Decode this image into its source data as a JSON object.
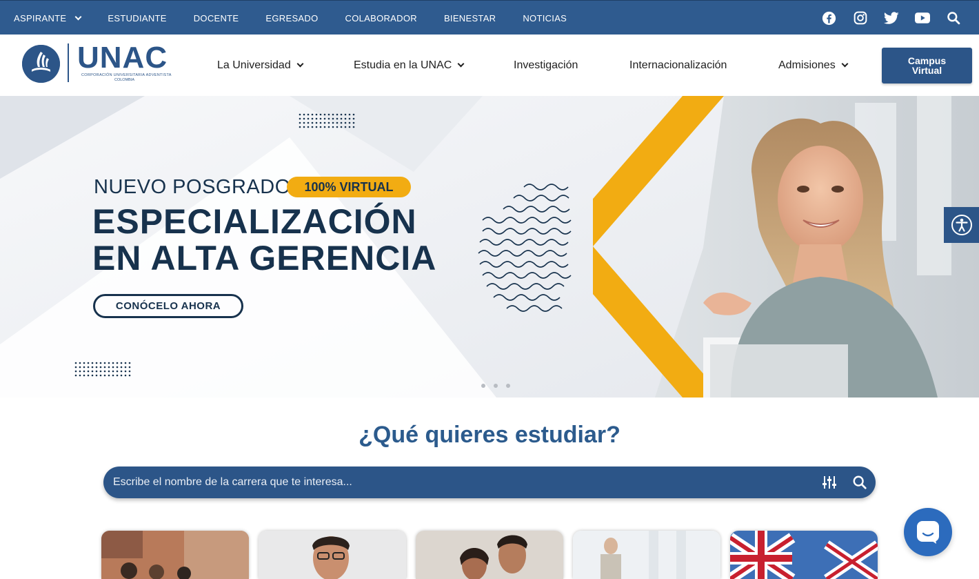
{
  "topbar": {
    "items": [
      {
        "label": "ASPIRANTE",
        "has_dropdown": true
      },
      {
        "label": "ESTUDIANTE"
      },
      {
        "label": "DOCENTE"
      },
      {
        "label": "EGRESADO"
      },
      {
        "label": "COLABORADOR"
      },
      {
        "label": "BIENESTAR"
      },
      {
        "label": "NOTICIAS"
      }
    ],
    "social_icons": [
      "facebook-icon",
      "instagram-icon",
      "twitter-icon",
      "youtube-icon",
      "search-icon"
    ],
    "bg_color": "#2f5b8f"
  },
  "logo": {
    "text": "UNAC",
    "subtitle_line1": "CORPORACIÓN UNIVERSITARIA ADVENTISTA",
    "subtitle_line2": "COLOMBIA"
  },
  "nav": {
    "items": [
      {
        "label": "La Universidad",
        "has_dropdown": true
      },
      {
        "label": "Estudia en la UNAC",
        "has_dropdown": true
      },
      {
        "label": "Investigación",
        "has_dropdown": false
      },
      {
        "label": "Internacionalización",
        "has_dropdown": false
      },
      {
        "label": "Admisiones",
        "has_dropdown": true
      }
    ],
    "campus_button": "Campus Virtual"
  },
  "hero": {
    "eyebrow": "NUEVO POSGRADO",
    "pill": "100% VIRTUAL",
    "title": "ESPECIALIZACIÓN\nEN ALTA GERENCIA",
    "cta": "CONÓCELO AHORA",
    "accent_color": "#f2ac12",
    "text_color": "#17324d",
    "slide_count": 3
  },
  "study": {
    "title": "¿Qué quieres estudiar?",
    "search_placeholder": "Escribe el nombre de la carrera que te interesa..."
  },
  "colors": {
    "brand": "#2c5588",
    "heading": "#2c5b8d",
    "chat": "#2c6bbd"
  }
}
